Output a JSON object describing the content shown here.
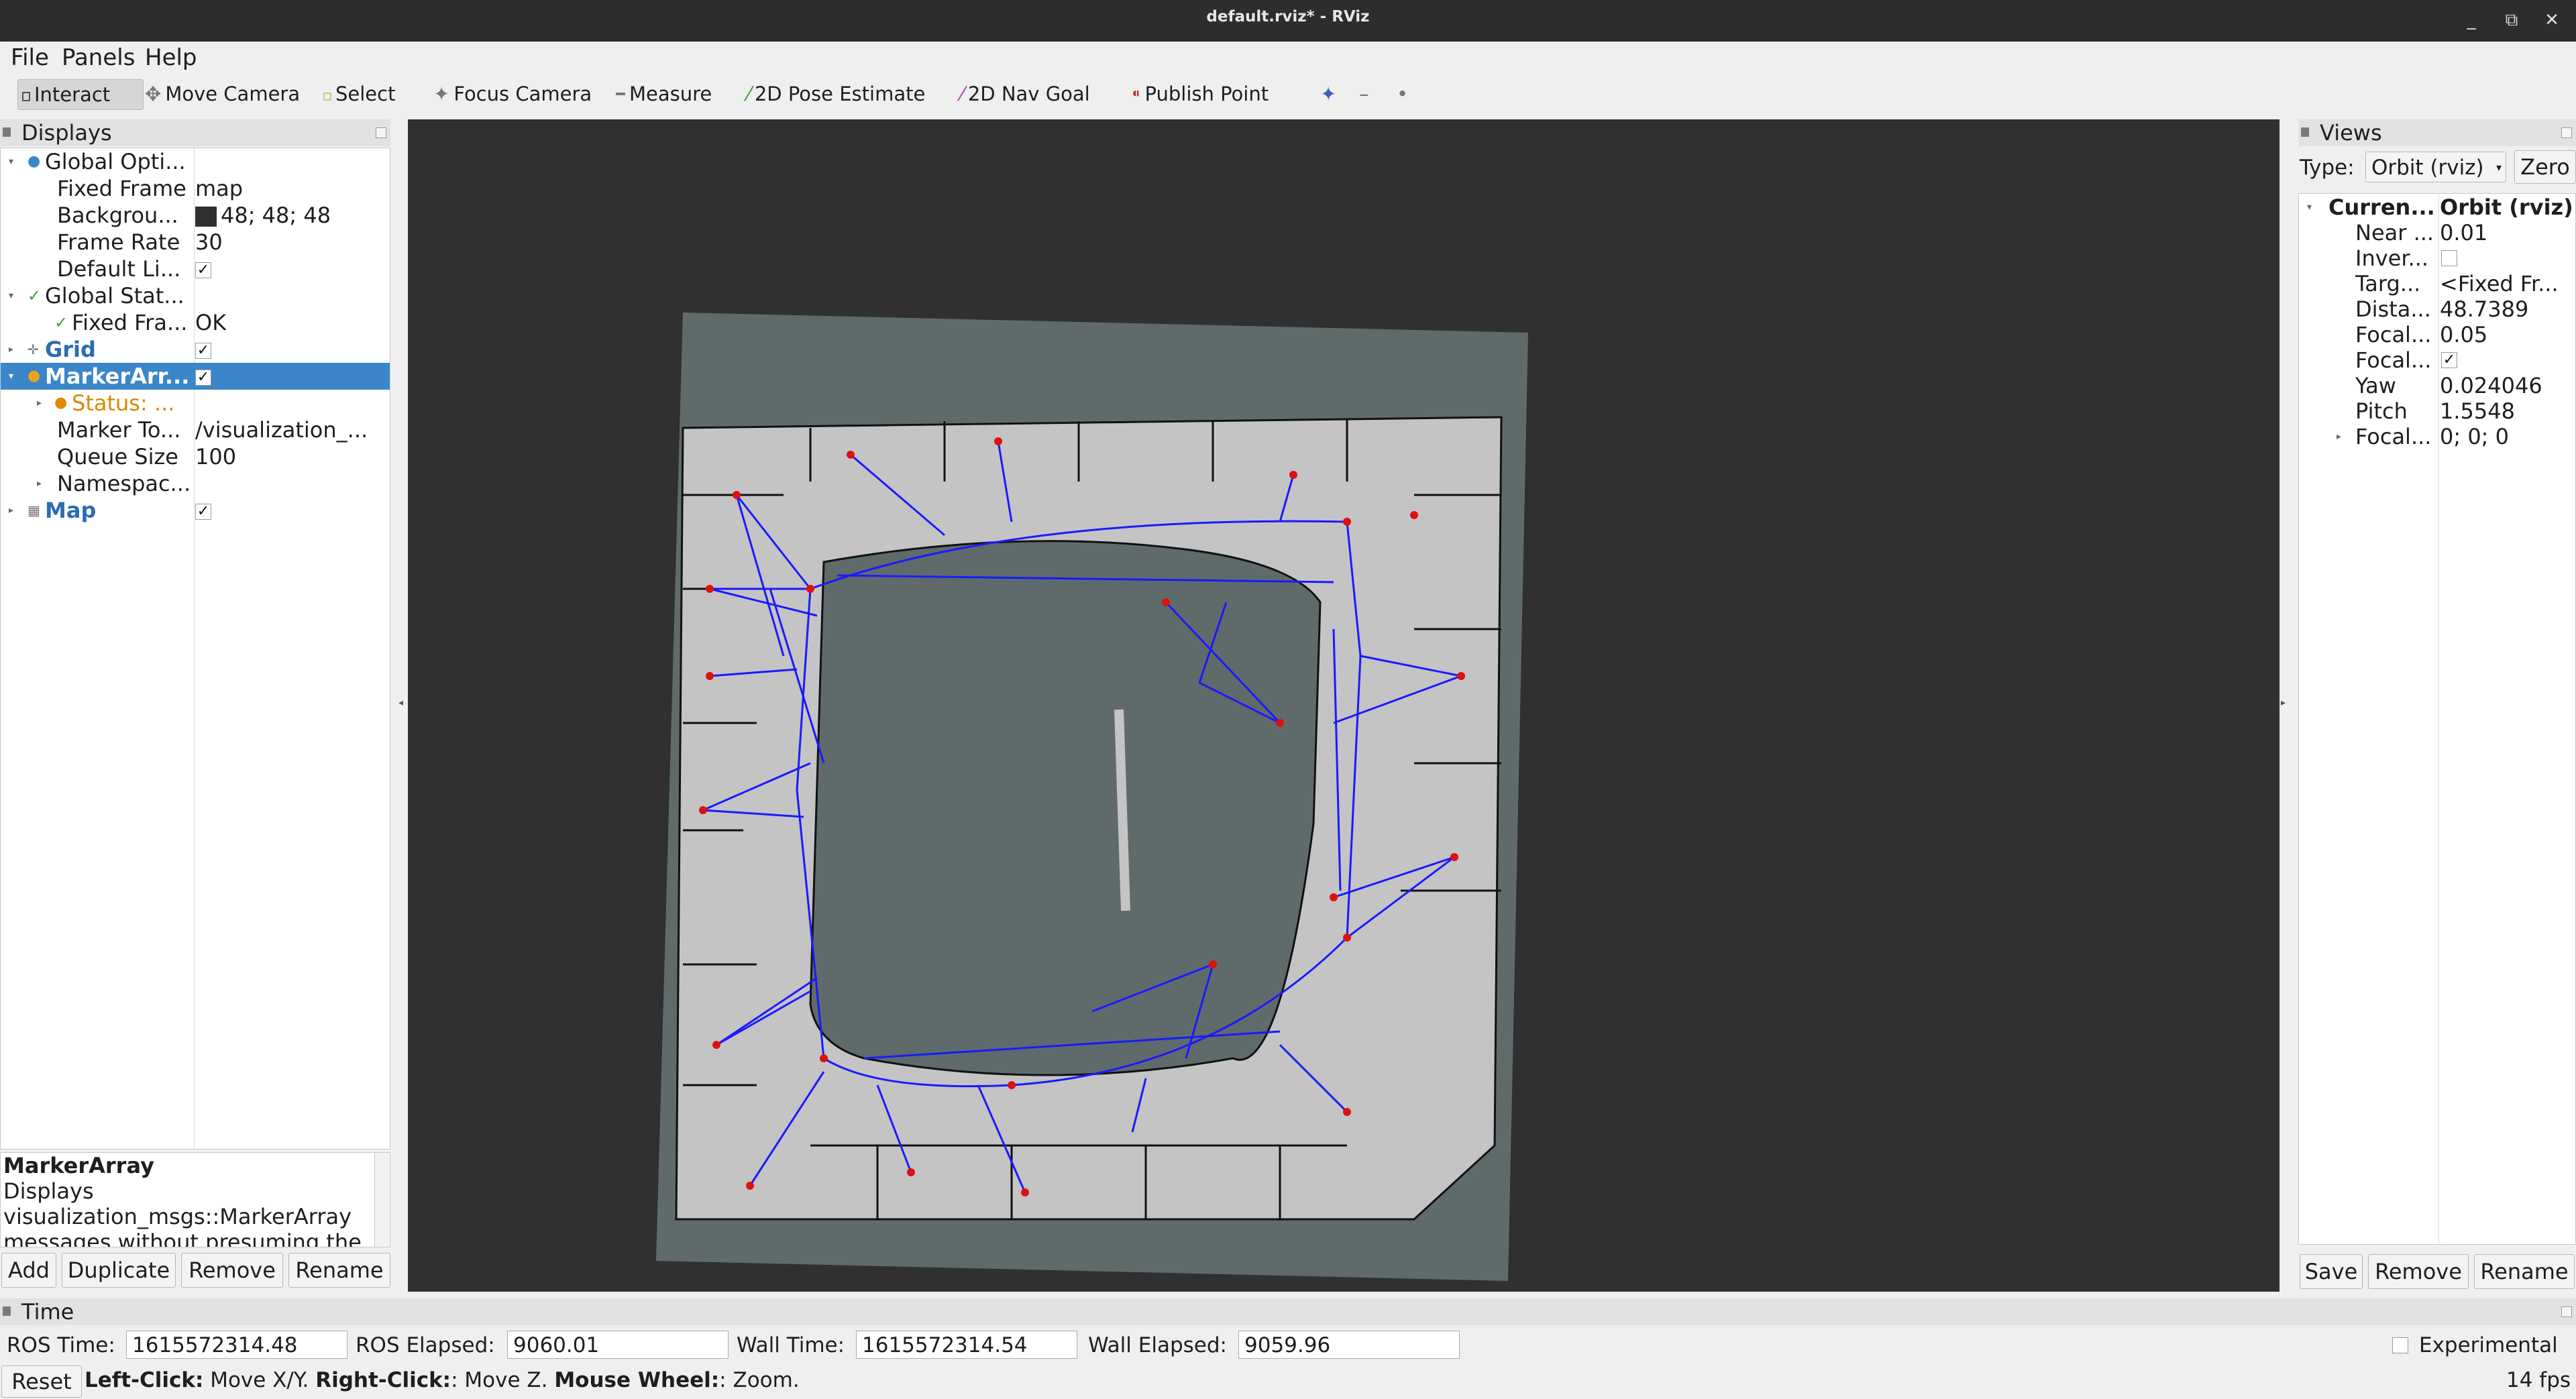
{
  "window": {
    "title": "default.rviz* - RViz"
  },
  "menubar": {
    "items": [
      "File",
      "Panels",
      "Help"
    ]
  },
  "toolbar": {
    "tools": [
      "Interact",
      "Move Camera",
      "Select",
      "Focus Camera",
      "Measure",
      "2D Pose Estimate",
      "2D Nav Goal",
      "Publish Point"
    ],
    "active": "Interact"
  },
  "displays": {
    "title": "Displays",
    "global_options": {
      "label": "Global Opti...",
      "fixed_frame_label": "Fixed Frame",
      "fixed_frame": "map",
      "background_label": "Backgrou...",
      "background": "48; 48; 48",
      "background_color": "#303030",
      "frame_rate_label": "Frame Rate",
      "frame_rate": "30",
      "default_light_label": "Default Li..."
    },
    "global_status": {
      "label": "Global Stat...",
      "fixed_frame_label": "Fixed Fra...",
      "fixed_frame": "OK"
    },
    "grid": {
      "label": "Grid"
    },
    "marker_array": {
      "label": "MarkerArr...",
      "status_label": "Status: ...",
      "topic_label": "Marker To...",
      "topic": "/visualization_...",
      "queue_label": "Queue Size",
      "queue": "100",
      "namespaces_label": "Namespac..."
    },
    "map": {
      "label": "Map"
    },
    "description": {
      "title": "MarkerArray",
      "line1": "Displays",
      "line2": "visualization_msgs::MarkerArray",
      "line3": "messages without presuming the"
    },
    "buttons": {
      "add": "Add",
      "duplicate": "Duplicate",
      "remove": "Remove",
      "rename": "Rename"
    }
  },
  "views": {
    "title": "Views",
    "type_label": "Type:",
    "type_value": "Orbit (rviz)",
    "zero": "Zero",
    "current_label": "Curren...",
    "current_value": "Orbit (rviz)",
    "props": [
      {
        "k": "Near ...",
        "v": "0.01"
      },
      {
        "k": "Inver...",
        "v": ""
      },
      {
        "k": "Targ...",
        "v": "<Fixed Fr..."
      },
      {
        "k": "Dista...",
        "v": "48.7389"
      },
      {
        "k": "Focal...",
        "v": "0.05"
      },
      {
        "k": "Focal...",
        "v": "✓"
      },
      {
        "k": "Yaw",
        "v": "0.024046"
      },
      {
        "k": "Pitch",
        "v": "1.5548"
      },
      {
        "k": "Focal...",
        "v": "0; 0; 0"
      }
    ],
    "buttons": {
      "save": "Save",
      "remove": "Remove",
      "rename": "Rename"
    }
  },
  "time": {
    "title": "Time",
    "ros_time_label": "ROS Time:",
    "ros_time": "1615572314.48",
    "ros_elapsed_label": "ROS Elapsed:",
    "ros_elapsed": "9060.01",
    "wall_time_label": "Wall Time:",
    "wall_time": "1615572314.54",
    "wall_elapsed_label": "Wall Elapsed:",
    "wall_elapsed": "9059.96",
    "experimental": "Experimental"
  },
  "status": {
    "reset": "Reset",
    "left_click_key": "Left-Click:",
    "left_click": "Move X/Y.",
    "right_click_key": "Right-Click:",
    "right_click": ": Move Z.",
    "wheel_key": "Mouse Wheel:",
    "wheel": ": Zoom.",
    "fps": "14 fps"
  },
  "colors": {
    "accent": "#3a86c8",
    "graph_edge": "#1a1aff",
    "graph_node": "#dd1111",
    "map_free": "#c4c4c4",
    "map_unknown": "#5f6b6b"
  }
}
